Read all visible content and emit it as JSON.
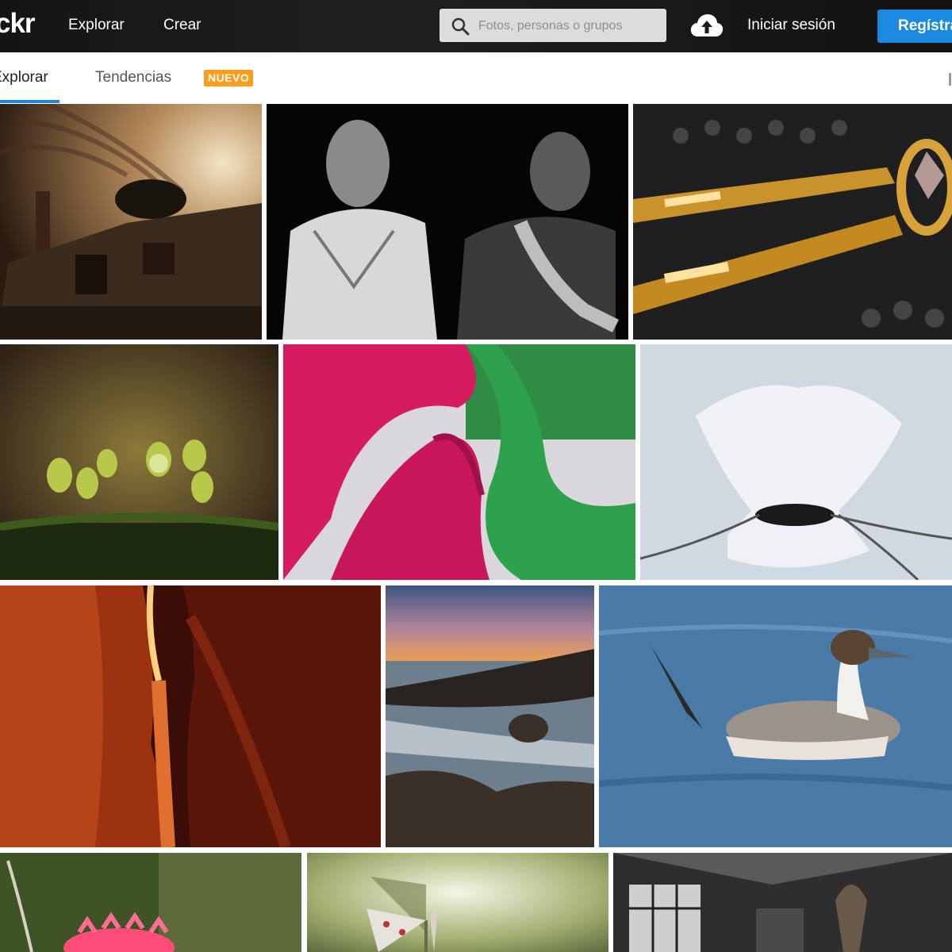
{
  "header": {
    "logo_text": "ckr",
    "nav": {
      "explore": "Explorar",
      "create": "Crear"
    },
    "search": {
      "placeholder": "Fotos, personas o grupos",
      "value": ""
    },
    "login": "Iniciar sesión",
    "signup": "Regístrate",
    "upload_icon": "cloud-upload-icon",
    "search_icon": "magnifier-icon"
  },
  "subnav": {
    "tabs": [
      {
        "label": "Explorar",
        "active": true
      },
      {
        "label": "Tendencias",
        "active": false
      }
    ],
    "badge": "NUEVO"
  },
  "colors": {
    "accent": "#1c89e0",
    "badge": "#ff9c1a",
    "topbar": "#1a1a1a",
    "search_bg": "#dcdcdc"
  },
  "gallery": {
    "photos": [
      {
        "subject": "abandoned-shack-at-dusk"
      },
      {
        "subject": "two-men-black-and-white-portrait"
      },
      {
        "subject": "gold-ring-and-pen-macro"
      },
      {
        "subject": "green-sprouts-with-water-drops"
      },
      {
        "subject": "pink-and-green-fabric-macro"
      },
      {
        "subject": "white-tulle-bag"
      },
      {
        "subject": "red-slot-canyon"
      },
      {
        "subject": "rocky-coast-at-sunset"
      },
      {
        "subject": "pintail-duck-on-water"
      },
      {
        "subject": "pink-gerbera-flower"
      },
      {
        "subject": "butterfly-on-plant"
      },
      {
        "subject": "abandoned-industrial-hall"
      }
    ]
  }
}
